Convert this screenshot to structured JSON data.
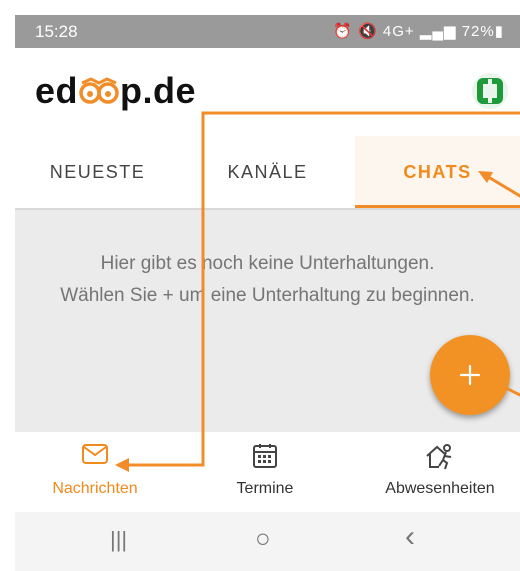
{
  "status_bar": {
    "time": "15:28",
    "icons": "⏰ 🔇 4G+ ▂▄▆ 72%▮",
    "battery": "72%"
  },
  "header": {
    "logo_prefix": "ed",
    "logo_suffix": "p.de",
    "avatar_color": "#1e9a3a"
  },
  "tabs": [
    {
      "label": "NEUESTE",
      "active": false
    },
    {
      "label": "KANÄLE",
      "active": false
    },
    {
      "label": "CHATS",
      "active": true
    }
  ],
  "content": {
    "empty_line1": "Hier gibt es noch keine Unterhaltungen.",
    "empty_line2": "Wählen Sie + um eine Unterhaltung zu beginnen."
  },
  "fab": {
    "icon": "plus-icon",
    "color": "#f39224"
  },
  "bottom_nav": [
    {
      "label": "Nachrichten",
      "icon": "envelope-icon",
      "active": true
    },
    {
      "label": "Termine",
      "icon": "calendar-icon",
      "active": false
    },
    {
      "label": "Abwesenheiten",
      "icon": "absence-icon",
      "active": false
    }
  ],
  "system_nav": {
    "recents": "|||",
    "home": "○",
    "back": "‹"
  },
  "colors": {
    "accent": "#f08a1c",
    "annotation": "#f28c28"
  }
}
